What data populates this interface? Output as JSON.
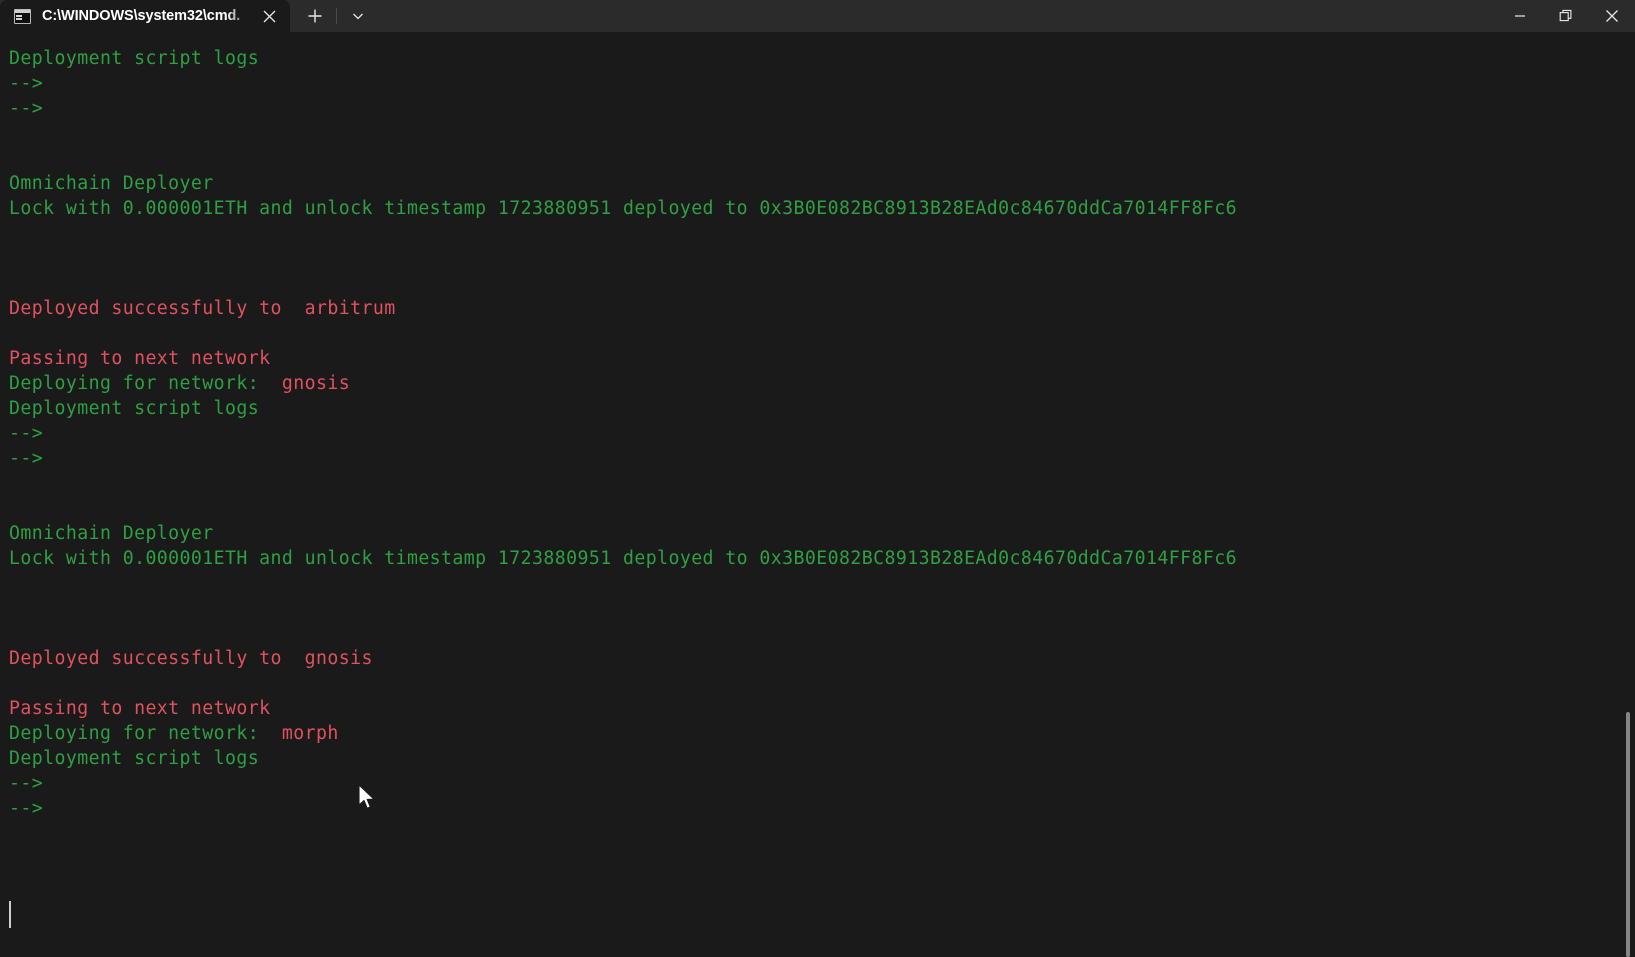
{
  "window": {
    "tab": {
      "title": "C:\\WINDOWS\\system32\\cmd.",
      "icon": "console-icon",
      "close_label": "✕"
    },
    "new_tab_label": "+",
    "dropdown_label": "⌄",
    "controls": {
      "minimize": "—",
      "restore": "❐",
      "close": "✕"
    }
  },
  "terminal": {
    "background": "#1a1a1a",
    "green": "#2ea043",
    "red": "#e05260",
    "cursor_color": "#cfcfcf",
    "lines": [
      {
        "segments": [
          {
            "text": "Deployment script logs",
            "color": "green"
          }
        ]
      },
      {
        "segments": [
          {
            "text": "-->",
            "color": "green"
          }
        ]
      },
      {
        "segments": [
          {
            "text": "-->",
            "color": "green"
          }
        ]
      },
      {
        "segments": [
          {
            "text": "",
            "color": "green"
          }
        ]
      },
      {
        "segments": [
          {
            "text": "",
            "color": "green"
          }
        ]
      },
      {
        "segments": [
          {
            "text": "Omnichain Deployer",
            "color": "green"
          }
        ]
      },
      {
        "segments": [
          {
            "text": "Lock with 0.000001ETH and unlock timestamp 1723880951 deployed to 0x3B0E082BC8913B28EAd0c84670ddCa7014FF8Fc6",
            "color": "green"
          }
        ]
      },
      {
        "segments": [
          {
            "text": "",
            "color": "green"
          }
        ]
      },
      {
        "segments": [
          {
            "text": "",
            "color": "green"
          }
        ]
      },
      {
        "segments": [
          {
            "text": "",
            "color": "green"
          }
        ]
      },
      {
        "segments": [
          {
            "text": "Deployed successfully to  arbitrum",
            "color": "red"
          }
        ]
      },
      {
        "segments": [
          {
            "text": "",
            "color": "green"
          }
        ]
      },
      {
        "segments": [
          {
            "text": "Passing to next network",
            "color": "red"
          }
        ]
      },
      {
        "segments": [
          {
            "text": "Deploying for network: ",
            "color": "green"
          },
          {
            "text": " gnosis",
            "color": "red"
          }
        ]
      },
      {
        "segments": [
          {
            "text": "Deployment script logs",
            "color": "green"
          }
        ]
      },
      {
        "segments": [
          {
            "text": "-->",
            "color": "green"
          }
        ]
      },
      {
        "segments": [
          {
            "text": "-->",
            "color": "green"
          }
        ]
      },
      {
        "segments": [
          {
            "text": "",
            "color": "green"
          }
        ]
      },
      {
        "segments": [
          {
            "text": "",
            "color": "green"
          }
        ]
      },
      {
        "segments": [
          {
            "text": "Omnichain Deployer",
            "color": "green"
          }
        ]
      },
      {
        "segments": [
          {
            "text": "Lock with 0.000001ETH and unlock timestamp 1723880951 deployed to 0x3B0E082BC8913B28EAd0c84670ddCa7014FF8Fc6",
            "color": "green"
          }
        ]
      },
      {
        "segments": [
          {
            "text": "",
            "color": "green"
          }
        ]
      },
      {
        "segments": [
          {
            "text": "",
            "color": "green"
          }
        ]
      },
      {
        "segments": [
          {
            "text": "",
            "color": "green"
          }
        ]
      },
      {
        "segments": [
          {
            "text": "Deployed successfully to  gnosis",
            "color": "red"
          }
        ]
      },
      {
        "segments": [
          {
            "text": "",
            "color": "green"
          }
        ]
      },
      {
        "segments": [
          {
            "text": "Passing to next network",
            "color": "red"
          }
        ]
      },
      {
        "segments": [
          {
            "text": "Deploying for network: ",
            "color": "green"
          },
          {
            "text": " morph",
            "color": "red"
          }
        ]
      },
      {
        "segments": [
          {
            "text": "Deployment script logs",
            "color": "green"
          }
        ]
      },
      {
        "segments": [
          {
            "text": "-->",
            "color": "green"
          }
        ]
      },
      {
        "segments": [
          {
            "text": "-->",
            "color": "green"
          }
        ]
      }
    ]
  }
}
